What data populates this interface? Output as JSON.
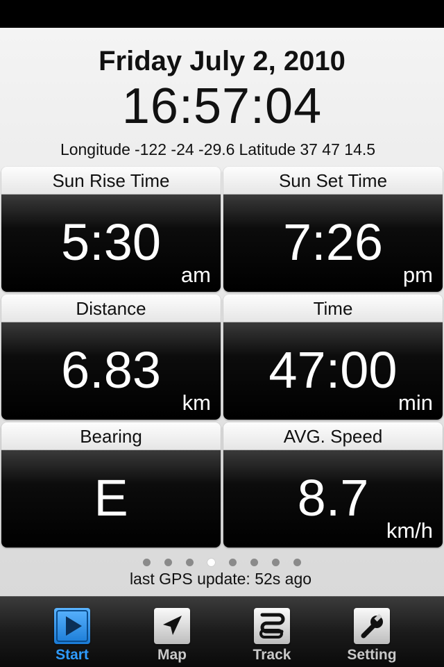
{
  "header": {
    "date": "Friday July 2, 2010",
    "time": "16:57:04",
    "longitude_label": "Longitude",
    "longitude_value": "-122 -24 -29.6",
    "latitude_label": "Latitude",
    "latitude_value": "37 47 14.5"
  },
  "tiles": [
    {
      "title": "Sun Rise Time",
      "value": "5:30",
      "unit": "am"
    },
    {
      "title": "Sun Set Time",
      "value": "7:26",
      "unit": "pm"
    },
    {
      "title": "Distance",
      "value": "6.83",
      "unit": "km"
    },
    {
      "title": "Time",
      "value": "47:00",
      "unit": "min"
    },
    {
      "title": "Bearing",
      "value": "E",
      "unit": ""
    },
    {
      "title": "AVG. Speed",
      "value": "8.7",
      "unit": "km/h"
    }
  ],
  "pager": {
    "count": 8,
    "active": 4
  },
  "gps_status": "last GPS update: 52s ago",
  "tabbar": {
    "items": [
      {
        "label": "Start",
        "icon": "play-icon",
        "active": true
      },
      {
        "label": "Map",
        "icon": "navigation-arrow-icon",
        "active": false
      },
      {
        "label": "Track",
        "icon": "track-path-icon",
        "active": false
      },
      {
        "label": "Setting",
        "icon": "wrench-icon",
        "active": false
      }
    ]
  },
  "colors": {
    "active_tab": "#2e9bff",
    "tile_body": "#000000",
    "background": "#e8e8e8"
  }
}
